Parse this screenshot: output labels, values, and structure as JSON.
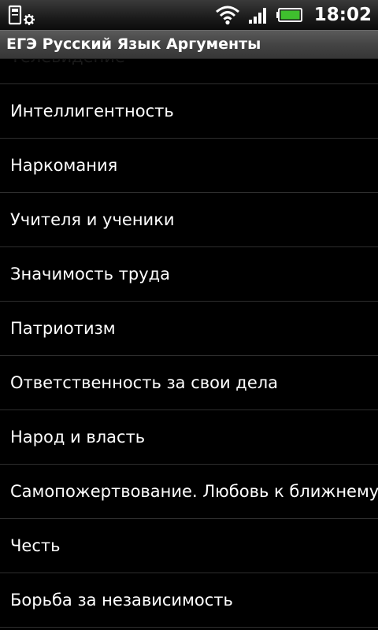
{
  "status_bar": {
    "time": "18:02",
    "icons": [
      "sd-card-icon",
      "settings-gear-icon",
      "wifi-icon",
      "signal-icon",
      "battery-icon"
    ],
    "battery_color": "#3fbf2e"
  },
  "title_bar": {
    "title": "ЕГЭ Русский Язык Аргументы"
  },
  "list": {
    "items": [
      {
        "label": "Телевидение"
      },
      {
        "label": "Интеллигентность"
      },
      {
        "label": "Наркомания"
      },
      {
        "label": "Учителя и ученики"
      },
      {
        "label": "Значимость труда"
      },
      {
        "label": "Патриотизм"
      },
      {
        "label": "Ответственность за свои дела"
      },
      {
        "label": "Народ и власть"
      },
      {
        "label": "Самопожертвование. Любовь к ближнему"
      },
      {
        "label": "Честь"
      },
      {
        "label": "Борьба за независимость"
      }
    ]
  }
}
